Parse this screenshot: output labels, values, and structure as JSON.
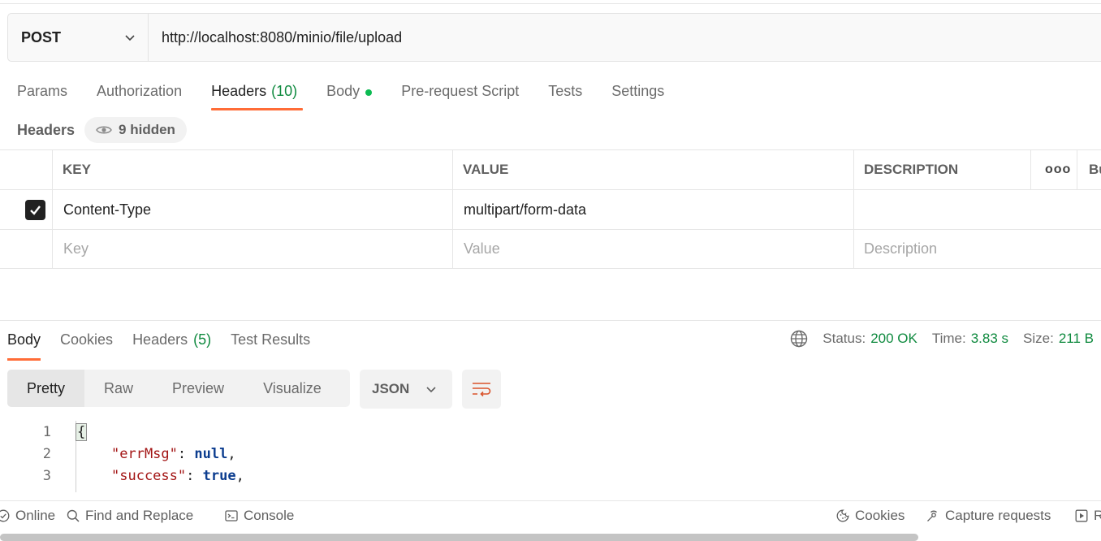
{
  "request": {
    "method": "POST",
    "url": "http://localhost:8080/minio/file/upload"
  },
  "request_tabs": [
    {
      "label": "Params"
    },
    {
      "label": "Authorization"
    },
    {
      "label": "Headers",
      "count": "(10)"
    },
    {
      "label": "Body"
    },
    {
      "label": "Pre-request Script"
    },
    {
      "label": "Tests"
    },
    {
      "label": "Settings"
    }
  ],
  "headers_section": {
    "title": "Headers",
    "hidden_label": "9 hidden"
  },
  "table": {
    "columns": [
      "KEY",
      "VALUE",
      "DESCRIPTION",
      "ooo",
      "Bu"
    ],
    "rows": [
      {
        "key": "Content-Type",
        "value": "multipart/form-data",
        "description": "",
        "checked": true
      }
    ],
    "placeholder": {
      "key": "Key",
      "value": "Value",
      "description": "Description"
    }
  },
  "response_tabs": [
    {
      "label": "Body"
    },
    {
      "label": "Cookies"
    },
    {
      "label": "Headers",
      "count": "(5)"
    },
    {
      "label": "Test Results"
    }
  ],
  "response_meta": {
    "status_label": "Status:",
    "status_value": "200 OK",
    "time_label": "Time:",
    "time_value": "3.83 s",
    "size_label": "Size:",
    "size_value": "211 B"
  },
  "format_tabs": [
    "Pretty",
    "Raw",
    "Preview",
    "Visualize"
  ],
  "format_type": "JSON",
  "code_lines": [
    {
      "num": "1",
      "brace": "{"
    },
    {
      "num": "2",
      "key": "\"errMsg\"",
      "sep": ": ",
      "value": "null",
      "end": ","
    },
    {
      "num": "3",
      "key": "\"success\"",
      "sep": ": ",
      "value": "true",
      "end": ","
    }
  ],
  "footer": {
    "online": "Online",
    "find_replace": "Find and Replace",
    "console": "Console",
    "cookies": "Cookies",
    "capture": "Capture requests",
    "runner": "R"
  },
  "colors": {
    "accent": "#ff6c37",
    "success": "#0f8a3f",
    "dot": "#0cbb52"
  }
}
